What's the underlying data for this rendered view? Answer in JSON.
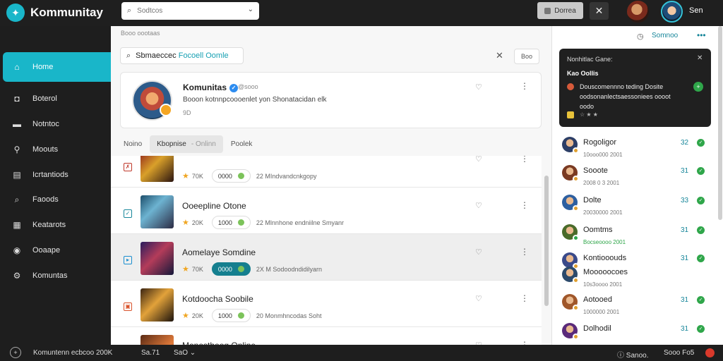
{
  "app": {
    "title": "Kommunitay",
    "logo_icon": "leaf-logo-icon"
  },
  "topbar": {
    "search_placeholder": "Sodtcos",
    "button_label": "Dorrea",
    "user_name": "Sen"
  },
  "sidebar": {
    "items": [
      {
        "label": "Home",
        "icon": "home-icon",
        "glyph": "⌂",
        "active": true
      },
      {
        "label": "Boterol",
        "icon": "bag-icon",
        "glyph": "◘"
      },
      {
        "label": "Notntoc",
        "icon": "chat-icon",
        "glyph": "▬"
      },
      {
        "label": "Moouts",
        "icon": "link-icon",
        "glyph": "⚲"
      },
      {
        "label": "Icrtantiods",
        "icon": "grid-icon",
        "glyph": "▤"
      },
      {
        "label": "Faoods",
        "icon": "search-icon",
        "glyph": "⌕"
      },
      {
        "label": "Keatarots",
        "icon": "store-icon",
        "glyph": "▦"
      },
      {
        "label": "Ooaape",
        "icon": "circle-icon",
        "glyph": "◉"
      },
      {
        "label": "Komuntas",
        "icon": "gear-icon",
        "glyph": "⚙"
      }
    ]
  },
  "main": {
    "breadcrumb": "Booo oootaas",
    "subsearch": {
      "prefix": "Sbmaeccec",
      "highlight": "Focoell Oomle"
    },
    "sub_chip": "Boo",
    "profile": {
      "name": "Komunitas",
      "handle": "@sooo",
      "description": "Booon kotnnpcoooenlet yon Shonatacidan elk",
      "stat": "9D"
    },
    "tabs": [
      {
        "label": "Noino"
      },
      {
        "label": "Kbopnise",
        "extra": "Onlinn",
        "selected": true
      },
      {
        "label": "Poolek"
      }
    ],
    "rows": [
      {
        "title": "",
        "rating": "70K",
        "pill": "0000",
        "gp": "22 MIndvandcnkgopy",
        "check": "✗",
        "check_color": "#c0392b",
        "highlight": false,
        "pill_teal": false,
        "thumb": "linear-gradient(135deg,#8b1b1b 0%,#d9a02a 45%,#2a1410 100%)"
      },
      {
        "title": "Ooeepline Otone",
        "rating": "20K",
        "pill": "1000",
        "gp": "22 Mlnnhone endniilne Smyanr",
        "check": "✓",
        "check_color": "#17869a",
        "highlight": false,
        "pill_teal": false,
        "thumb": "linear-gradient(135deg,#1d4e6b 0%,#6db3d1 40%,#2b2b44 100%)"
      },
      {
        "title": "Aomelaye Somdine",
        "rating": "70K",
        "pill": "0000",
        "gp": "2X M Sodoodndidilyarn",
        "check": "▸",
        "check_color": "#1a8fd0",
        "highlight": true,
        "pill_teal": true,
        "thumb": "linear-gradient(135deg,#2a1d5e 0%,#b43c5a 45%,#14183a 100%)"
      },
      {
        "title": "Kotdoocha Soobile",
        "rating": "20K",
        "pill": "1000",
        "gp": "20 Monmhncodas Soht",
        "check": "▣",
        "check_color": "#d9532b",
        "highlight": false,
        "pill_teal": false,
        "thumb": "linear-gradient(135deg,#3a2412 0%,#e2a23a 45%,#1b120c 100%)"
      },
      {
        "title": "Monosthoog Online",
        "rating": "",
        "pill": "",
        "gp": "",
        "check": "",
        "check_color": "#888",
        "highlight": false,
        "pill_teal": false,
        "thumb": "linear-gradient(135deg,#5a2a14 0%,#e07a3a 60%,#2a1a12 100%)"
      }
    ]
  },
  "right": {
    "header_link": "Somnoo",
    "notification": {
      "title": "Nonhitlac Gane:",
      "subtitle": "Kao Oollis",
      "body": "Douscomennno teding Dosite oodsonanlectsaessoniees oooot oodo",
      "stars": "☆ ★ ★"
    },
    "friends": [
      {
        "name": "Rogoligor",
        "status": "10ooo000 2001",
        "num": "32",
        "online": false,
        "color": "#2c3e66"
      },
      {
        "name": "Sooote",
        "status": "2008 0 3 2001",
        "num": "31",
        "online": false,
        "color": "#7a3a22"
      },
      {
        "name": "Dolte",
        "status": "20030000 2001",
        "num": "33",
        "online": false,
        "color": "#2d5fa0"
      },
      {
        "name": "Oomtms",
        "status": "Bocseoooo 2001",
        "num": "31",
        "online": true,
        "color": "#4a6b2a"
      },
      {
        "name": "Kontiooouds",
        "status": "",
        "num": "31",
        "online": false,
        "color": "#3a4a8a"
      },
      {
        "name": "Mooooocoes",
        "status": "10s3oooo 2001",
        "num": "",
        "online": false,
        "color": "#2c4a6b"
      },
      {
        "name": "Aotooed",
        "status": "1000000 2001",
        "num": "31",
        "online": false,
        "color": "#a0572a"
      },
      {
        "name": "Dolhodil",
        "status": "",
        "num": "31",
        "online": false,
        "color": "#5a2a7a"
      }
    ]
  },
  "bottombar": {
    "text": "Komuntenn ecbcoo 200K",
    "value1": "Sa.71",
    "value2": "SaO",
    "status": "Sanoo.",
    "version": "Sooo Fo5"
  }
}
